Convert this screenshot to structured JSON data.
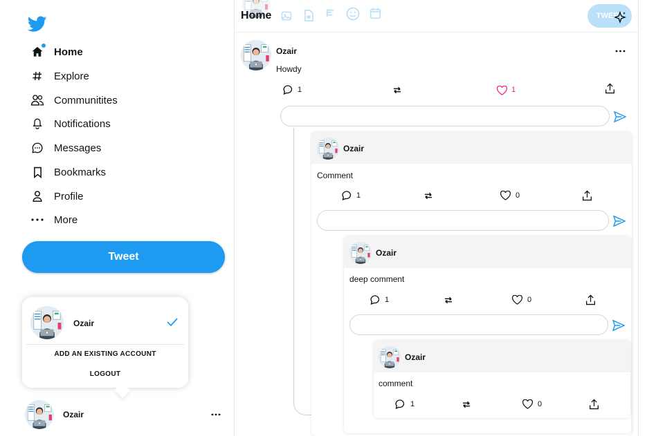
{
  "sidebar": {
    "items": [
      {
        "label": "Home",
        "icon": "home-icon",
        "active": true
      },
      {
        "label": "Explore",
        "icon": "hashtag-icon"
      },
      {
        "label": "Communitites",
        "icon": "people-icon"
      },
      {
        "label": "Notifications",
        "icon": "bell-icon"
      },
      {
        "label": "Messages",
        "icon": "message-icon"
      },
      {
        "label": "Bookmarks",
        "icon": "bookmark-icon"
      },
      {
        "label": "Profile",
        "icon": "person-icon"
      },
      {
        "label": "More",
        "icon": "more-icon"
      }
    ],
    "tweet_label": "Tweet",
    "account_popover": {
      "name": "Ozair",
      "add_account": "ADD AN EXISTING ACCOUNT",
      "logout": "LOGOUT"
    },
    "account": {
      "name": "Ozair"
    }
  },
  "header": {
    "title": "Home",
    "tweet_label": "TWEET"
  },
  "post": {
    "author": "Ozair",
    "text": "Howdy",
    "replies": "1",
    "likes": "1",
    "comments": [
      {
        "author": "Ozair",
        "text": "Comment",
        "replies": "1",
        "likes": "0",
        "comments": [
          {
            "author": "Ozair",
            "text": "deep comment",
            "replies": "1",
            "likes": "0",
            "comments": [
              {
                "author": "Ozair",
                "text": "comment",
                "replies": "1",
                "likes": "0"
              }
            ]
          }
        ]
      }
    ]
  },
  "colors": {
    "accent": "#1d9bf0",
    "like": "#f91880"
  }
}
